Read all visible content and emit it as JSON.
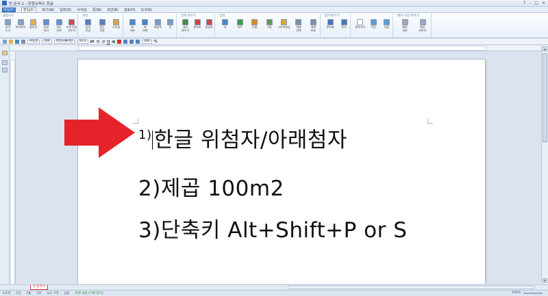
{
  "window": {
    "title": "빈 문서 1 - 한컴오피스 한글",
    "controls": [
      "?",
      "–",
      "□",
      "×"
    ]
  },
  "menu": {
    "tabs": [
      {
        "label": "파일(F)",
        "state": "file"
      },
      {
        "label": "편집(E)",
        "state": "active"
      },
      {
        "label": "보기(W)",
        "state": ""
      },
      {
        "label": "입력(D)",
        "state": ""
      },
      {
        "label": "서식(J)",
        "state": ""
      },
      {
        "label": "쪽(W)",
        "state": ""
      },
      {
        "label": "보안(R)",
        "state": ""
      },
      {
        "label": "검토(H)",
        "state": ""
      },
      {
        "label": "도구(K)",
        "state": ""
      }
    ]
  },
  "ribbon": {
    "groups": [
      {
        "name": "클립보드",
        "tools": [
          {
            "label": "오려\n두기",
            "color": "#8aa2c0"
          },
          {
            "label": "복사하기",
            "color": "#8aa2c0"
          },
          {
            "label": "붙이기",
            "color": "#e0b44a"
          },
          {
            "label": "모양\n복사",
            "color": "#6c8fc7"
          },
          {
            "label": "모두\n선택",
            "color": "#6c8fc7"
          },
          {
            "label": "조판 부호\n지우기",
            "color": "#d34f4f"
          }
        ]
      },
      {
        "name": "서식",
        "tools": [
          {
            "label": "글자\n모양",
            "color": "#5a7fbf"
          },
          {
            "label": "문단\n모양",
            "color": "#5a7fbf"
          },
          {
            "label": "스타일",
            "color": "#d9a441"
          }
        ]
      },
      {
        "name": "",
        "tools": [
          {
            "label": "표\n기본",
            "color": "#4b86c8"
          },
          {
            "label": "표\n여백",
            "color": "#4b86c8"
          },
          {
            "label": "바탕쪽",
            "color": "#7c9bc4"
          },
          {
            "label": "단",
            "color": "#7c9bc4"
          }
        ]
      },
      {
        "name": "글자 바꾸기",
        "tools": [
          {
            "label": "글자\n바꾸기",
            "color": "#4e8a3c"
          },
          {
            "label": "한자로",
            "color": "#c44"
          },
          {
            "label": "한글로",
            "color": "#c44"
          }
        ]
      },
      {
        "name": "입력",
        "tools": [
          {
            "label": "표",
            "color": "#4b86c8"
          },
          {
            "label": "차트",
            "color": "#3c9a4f"
          },
          {
            "label": "도형",
            "color": "#d68a2c"
          },
          {
            "label": "그림",
            "color": "#5c9a5a"
          },
          {
            "label": "그리기마당",
            "color": "#d4a83a"
          },
          {
            "label": "개체\n선택",
            "color": "#7d8fa9"
          },
          {
            "label": "개체\n보호",
            "color": "#7d8fa9"
          }
        ]
      },
      {
        "name": "찾기/바꾸기",
        "tools": [
          {
            "label": "문자표",
            "color": "#4a74b8"
          },
          {
            "label": "찾기",
            "color": "#4a74b8"
          }
        ]
      },
      {
        "name": "",
        "tools": [
          {
            "label": "찾아가기",
            "color": "#ffffff"
          },
          {
            "label": "이전",
            "color": "#5aa0d8"
          },
          {
            "label": "다음",
            "color": "#5aa0d8"
          }
        ]
      },
      {
        "name": "메모 모양 바꾸기",
        "tools": [
          {
            "label": "메모\n모양",
            "color": "#9aa8bb"
          },
          {
            "label": "메모\n바꾸기",
            "color": "#9aa8bb"
          }
        ]
      }
    ]
  },
  "format": {
    "style": "바탕글",
    "lang": "대표",
    "font": "한컴소몰바탕",
    "size": "10.0",
    "unit": "pt",
    "bold": "가",
    "italic": "가",
    "underline": "가",
    "strike": "가",
    "zoom": "160",
    "pct": "%"
  },
  "document": {
    "lines": [
      {
        "num": "1)",
        "text": "한글 위첨자/아래첨자"
      },
      {
        "num": "",
        "text": "2)제곱 100m2"
      },
      {
        "num": "",
        "text": "3)단축키 Alt+Shift+P or S"
      }
    ]
  },
  "tabs": {
    "doc": "빈 문서 1"
  },
  "status": {
    "page": "1/1쪽",
    "section": "1단",
    "line": "1줄",
    "col": "1칸",
    "total": "1/1 구역",
    "mode": "삽입",
    "track": "변경 내용 [기록 중지]",
    "zoom": "160%"
  },
  "colors": {
    "arrow": "#e4232a",
    "accent": "#2d6fc0"
  }
}
